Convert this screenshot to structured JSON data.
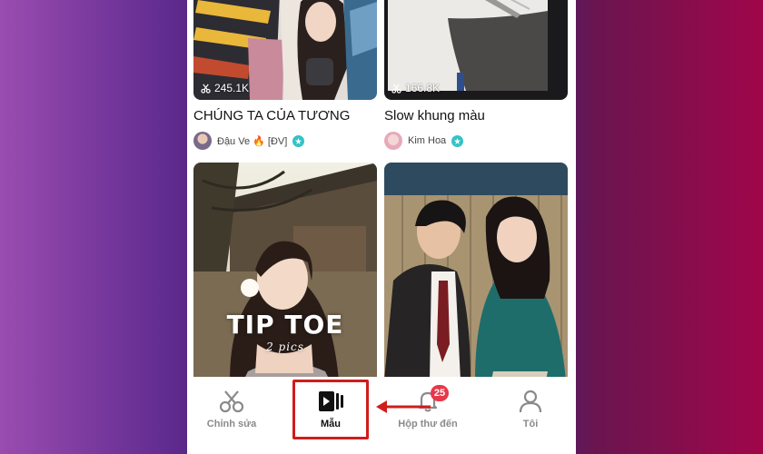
{
  "cards": [
    {
      "views": "245.1K",
      "title": "CHÚNG TA CỦA TƯƠNG",
      "author": "Đậu Ve 🔥 [ĐV]"
    },
    {
      "views": "166.8K",
      "title": "Slow khung màu",
      "author": "Kim Hoa"
    },
    {
      "overlay_title": "TIP TOE",
      "overlay_sub": "2 pics"
    },
    {}
  ],
  "tabbar": {
    "items": [
      {
        "label": "Chỉnh sửa",
        "icon": "scissors-icon"
      },
      {
        "label": "Mẫu",
        "icon": "template-play-icon",
        "active": true
      },
      {
        "label": "Hộp thư đến",
        "icon": "bell-icon",
        "badge": "25"
      },
      {
        "label": "Tôi",
        "icon": "person-icon"
      }
    ]
  },
  "colors": {
    "highlight": "#d11c1c",
    "badge": "#e8374a",
    "verified": "#33c2c8"
  }
}
